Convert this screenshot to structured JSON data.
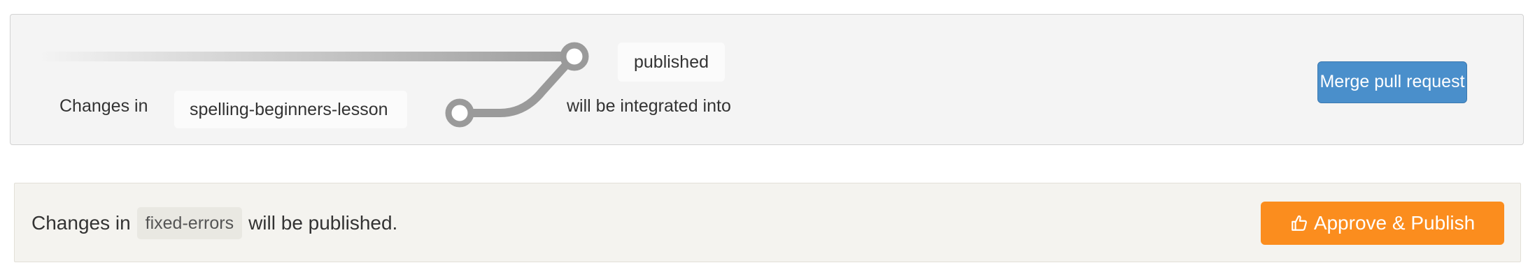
{
  "merge_panel": {
    "changes_in_label": "Changes in",
    "source_branch": "spelling-beginners-lesson",
    "target_branch": "published",
    "integrated_label": "will be integrated into",
    "merge_button_label": "Merge pull request",
    "merge_button_color": "#4a8fcb"
  },
  "publish_panel": {
    "changes_in_label": "Changes in",
    "branch": "fixed-errors",
    "suffix": "will be published.",
    "approve_button_label": "Approve & Publish",
    "approve_button_icon": "thumbs-up-icon",
    "approve_button_color": "#fb8d1e"
  }
}
